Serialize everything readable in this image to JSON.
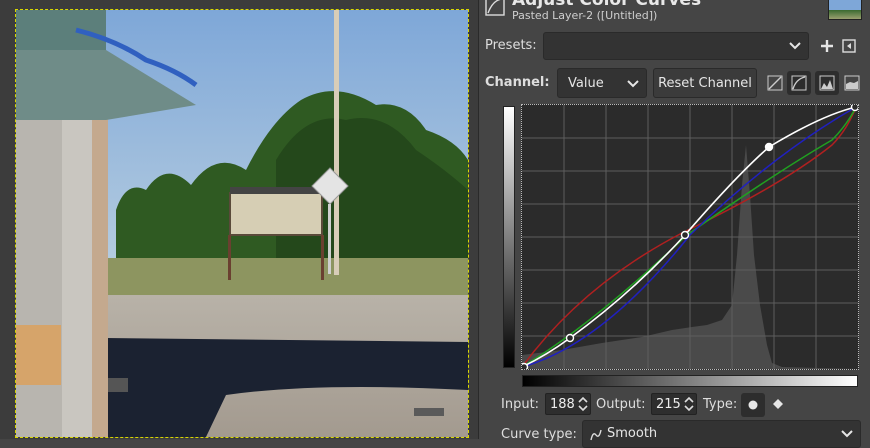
{
  "dialog": {
    "title": "Adjust Color Curves",
    "subtitle": "Pasted Layer-2 ([Untitled])"
  },
  "presets": {
    "label": "Presets:",
    "value": ""
  },
  "channel": {
    "label": "Channel:",
    "value": "Value",
    "reset_label": "Reset Channel"
  },
  "curve": {
    "input_label": "Input:",
    "input_value": "188",
    "output_label": "Output:",
    "output_value": "215",
    "type_label": "Type:",
    "curve_type_label": "Curve type:",
    "curve_type_value": "Smooth"
  },
  "icons": {
    "add_preset": "plus-icon",
    "manage_presets": "presets-menu-icon",
    "linear_histogram": "linear-histogram-icon",
    "log_histogram": "logarithmic-histogram-icon",
    "point_smooth": "smooth-point-icon",
    "point_corner": "corner-point-icon"
  },
  "colors": {
    "panel_bg": "#454545",
    "graph_bg": "#2b2b2b",
    "curve_value": "#ffffff",
    "curve_red": "#b02020",
    "curve_green": "#20a020",
    "curve_blue": "#2020c0",
    "selection_outline": "#d8d800"
  }
}
